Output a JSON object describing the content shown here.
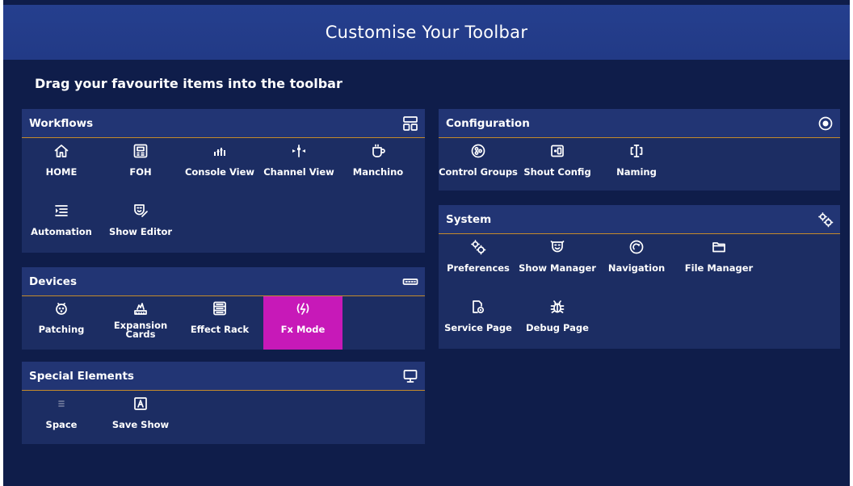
{
  "title": "Customise Your Toolbar",
  "subtitle": "Drag your favourite items into the toolbar",
  "workflows": {
    "title": "Workflows",
    "header_icon": "layout-icon",
    "items": [
      {
        "label": "HOME",
        "icon": "home-icon"
      },
      {
        "label": "FOH",
        "icon": "foh-icon"
      },
      {
        "label": "Console View",
        "icon": "console-view-icon"
      },
      {
        "label": "Channel View",
        "icon": "channel-view-icon"
      },
      {
        "label": "Manchino",
        "icon": "mug-icon"
      },
      {
        "label": "Automation",
        "icon": "automation-icon"
      },
      {
        "label": "Show Editor",
        "icon": "mask-edit-icon"
      }
    ]
  },
  "devices": {
    "title": "Devices",
    "header_icon": "device-bar-icon",
    "items": [
      {
        "label": "Patching",
        "icon": "patching-icon"
      },
      {
        "label": "Expansion Cards",
        "icon": "expansion-card-icon"
      },
      {
        "label": "Effect Rack",
        "icon": "rack-icon"
      },
      {
        "label": "Fx Mode",
        "icon": "fx-mode-icon",
        "active": true
      }
    ]
  },
  "special": {
    "title": "Special Elements",
    "header_icon": "monitor-icon",
    "items": [
      {
        "label": "Space",
        "icon": "space-icon"
      },
      {
        "label": "Save Show",
        "icon": "save-show-icon"
      }
    ]
  },
  "configuration": {
    "title": "Configuration",
    "header_icon": "target-icon",
    "items": [
      {
        "label": "Control Groups",
        "icon": "control-groups-icon"
      },
      {
        "label": "Shout Config",
        "icon": "shout-config-icon"
      },
      {
        "label": "Naming",
        "icon": "naming-icon"
      }
    ]
  },
  "system": {
    "title": "System",
    "header_icon": "gears-icon",
    "items": [
      {
        "label": "Preferences",
        "icon": "gears-icon"
      },
      {
        "label": "Show Manager",
        "icon": "mask-icon"
      },
      {
        "label": "Navigation",
        "icon": "navigation-icon"
      },
      {
        "label": "File Manager",
        "icon": "folder-icon"
      },
      {
        "label": "Service Page",
        "icon": "service-icon"
      },
      {
        "label": "Debug Page",
        "icon": "bug-icon"
      }
    ]
  },
  "colors": {
    "background": "#0f1d4a",
    "title_bar": "#233d8a",
    "panel": "#1c2d63",
    "panel_header": "#223574",
    "header_underline": "#c48a2a",
    "active_item": "#c719b8"
  }
}
